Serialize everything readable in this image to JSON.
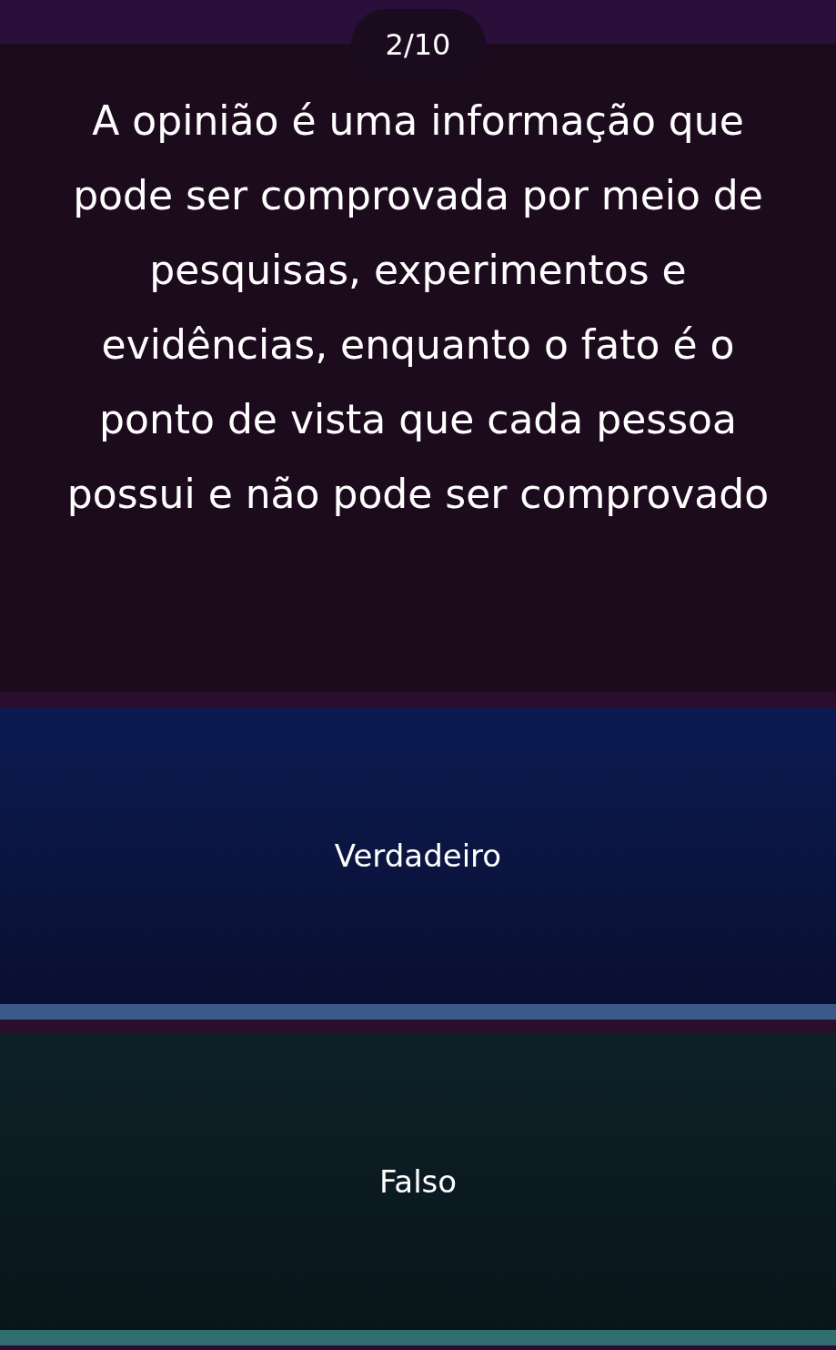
{
  "progress": {
    "counter": "2/10"
  },
  "question": {
    "text": "A opinião é uma informação que pode ser comprovada por meio de pesquisas, experimentos e evidências, enquanto o fato é o ponto de vista que cada pessoa possui e não pode ser comprovado"
  },
  "options": [
    {
      "label": "Verdadeiro"
    },
    {
      "label": "Falso"
    }
  ]
}
